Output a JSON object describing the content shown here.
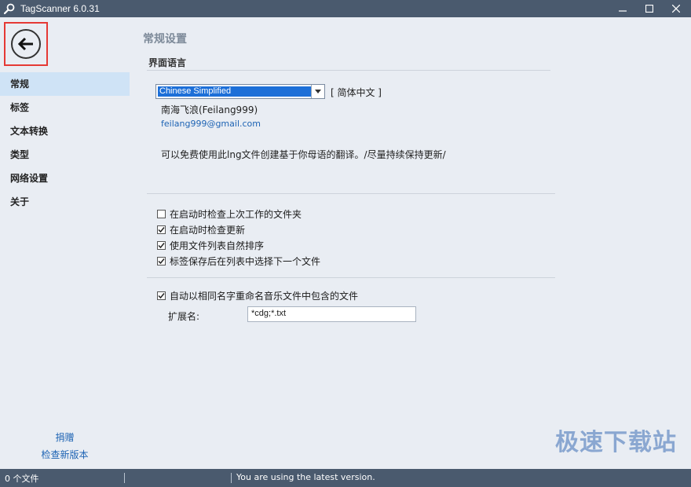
{
  "window": {
    "title": "TagScanner 6.0.31"
  },
  "sidebar": {
    "items": [
      {
        "label": "常规",
        "active": true
      },
      {
        "label": "标签"
      },
      {
        "label": "文本转换"
      },
      {
        "label": "类型"
      },
      {
        "label": "网络设置"
      },
      {
        "label": "关于"
      }
    ],
    "donate": "捐赠",
    "check_update": "检查新版本"
  },
  "main": {
    "page_title": "常规设置",
    "lang_section": "界面语言",
    "language": {
      "selected": "Chinese Simplified",
      "native": "[ 简体中文 ]"
    },
    "author": "南海飞浪(Feilang999)",
    "email": "feilang999@gmail.com",
    "translate_note": "可以免费使用此lng文件创建基于你母语的翻译。/尽量持续保持更新/",
    "options": [
      {
        "label": "在启动时检查上次工作的文件夹",
        "checked": false
      },
      {
        "label": "在启动时检查更新",
        "checked": true
      },
      {
        "label": "使用文件列表自然排序",
        "checked": true
      },
      {
        "label": "标签保存后在列表中选择下一个文件",
        "checked": true
      }
    ],
    "rename_option": {
      "label": "自动以相同名字重命名音乐文件中包含的文件",
      "checked": true
    },
    "ext_label": "扩展名:",
    "ext_value": "*cdg;*.txt"
  },
  "status": {
    "file_count": "0 个文件",
    "message": "You are using the latest version."
  },
  "watermark": "极速下载站",
  "colors": {
    "titlebar": "#4a5a6e",
    "sidebar_active": "#cfe3f6",
    "link": "#1e64b4",
    "back_highlight": "#e53935"
  }
}
